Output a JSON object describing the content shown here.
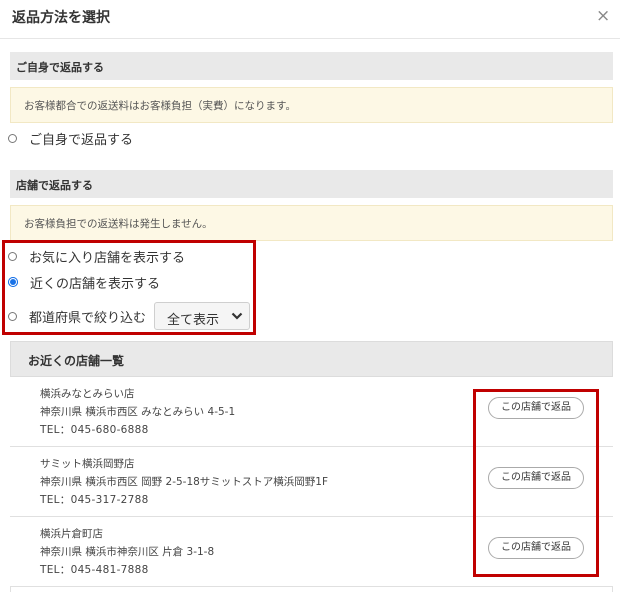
{
  "dialog": {
    "title": "返品方法を選択",
    "close_glyph": "×"
  },
  "self_return": {
    "section_title": "ご自身で返品する",
    "notice": "お客様都合での返送料はお客様負担（実費）になります。",
    "option_label": "ご自身で返品する"
  },
  "store_return": {
    "section_title": "店舗で返品する",
    "notice": "お客様負担での返送料は発生しません。",
    "options": [
      {
        "label": "お気に入り店舗を表示する",
        "selected": false
      },
      {
        "label": "近くの店舗を表示する",
        "selected": true
      },
      {
        "label": "都道府県で絞り込む",
        "selected": false
      }
    ],
    "prefecture_select": {
      "value": "全て表示"
    }
  },
  "store_list": {
    "heading": "お近くの店舗一覧",
    "button_label": "この店舗で返品",
    "stores": [
      {
        "name": "横浜みなとみらい店",
        "address": "神奈川県 横浜市西区 みなとみらい 4-5-1",
        "tel": "TEL：045-680-6888"
      },
      {
        "name": "サミット横浜岡野店",
        "address": "神奈川県 横浜市西区 岡野 2-5-18サミットストア横浜岡野1F",
        "tel": "TEL：045-317-2788"
      },
      {
        "name": "横浜片倉町店",
        "address": "神奈川県 横浜市神奈川区 片倉 3-1-8",
        "tel": "TEL：045-481-7888"
      }
    ]
  },
  "colors": {
    "highlight": "#c00000",
    "radio_selected": "#1a73e8",
    "notice_bg": "#fdf8e5",
    "section_bg": "#e9e9e9"
  }
}
